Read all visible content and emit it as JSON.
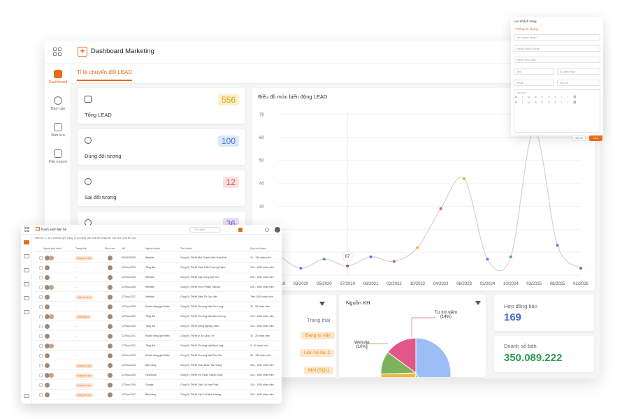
{
  "app": {
    "title": "Dashboard Marketing",
    "active_tab": "Tỉ lệ chuyển đổi LEAD"
  },
  "sidebar": [
    {
      "label": "Dashboard",
      "active": true
    },
    {
      "label": "Báo cáo",
      "active": false
    },
    {
      "label": "Bản lưu",
      "active": false
    },
    {
      "label": "File export",
      "active": false
    }
  ],
  "stats": [
    {
      "label": "Tổng LEAD",
      "value": "556",
      "bg": "#fdf0c8",
      "fg": "#d9a21e"
    },
    {
      "label": "Đúng đối tượng",
      "value": "100",
      "bg": "#dde9fb",
      "fg": "#3f74c8"
    },
    {
      "label": "Sai đối tượng",
      "value": "12",
      "bg": "#fbe0e0",
      "fg": "#d9534f"
    },
    {
      "label": "",
      "value": "36",
      "bg": "#e9e2fa",
      "fg": "#7a5ac8"
    }
  ],
  "chart_data": {
    "type": "line",
    "title": "Biểu đồ mức biến động LEAD",
    "categories": [
      "12/2019",
      "03/2020",
      "05/2020",
      "07/2020",
      "08/2021",
      "02/2022",
      "10/2022",
      "04/2023",
      "08/2023",
      "03/2024",
      "10/2024",
      "03/2025",
      "08/2025",
      "02/2026"
    ],
    "values": [
      9,
      3,
      7,
      4,
      8,
      6,
      12,
      29,
      42,
      7,
      8,
      63,
      13,
      3
    ],
    "point_colors": [
      "#e0e0e0",
      "#5b7fd8",
      "#4caf50",
      "#b05a2a",
      "#5b7fd8",
      "#d94a8c",
      "#f2b01e",
      "#e2574c",
      "#f2b01e",
      "#5b7fd8",
      "#4caf50",
      "#bbbbbb",
      "#5b7fd8",
      "#8a5ac8"
    ],
    "yticks": [
      0,
      10,
      20,
      30,
      40,
      50,
      60,
      70
    ],
    "ylim": [
      0,
      70
    ],
    "tooltip_label": "07",
    "tooltip_index": 3
  },
  "status_card": {
    "header": "Trạng thái",
    "pills": [
      "Đang tư vấn",
      "Liên hệ lần 2",
      "Mới (SQL)"
    ]
  },
  "source_card": {
    "title": "Nguồn KH",
    "labels": [
      {
        "text": "Tự tìm kiếm",
        "pct": "(14%)"
      },
      {
        "text": "Website",
        "pct": "(10%)"
      }
    ],
    "slices": [
      {
        "value": 40,
        "color": "#9dbdf7"
      },
      {
        "value": 8,
        "color": "#4fb8b0"
      },
      {
        "value": 22,
        "color": "#f2b63a"
      },
      {
        "value": 10,
        "color": "#7cb35a"
      },
      {
        "value": 14,
        "color": "#e2578a"
      }
    ]
  },
  "contracts": {
    "label": "Hợp đồng bán",
    "value": "169",
    "color": "#3f6fb8"
  },
  "revenue": {
    "label": "Doanh số bán",
    "value": "350.089.222",
    "color": "#2e9a55"
  },
  "form": {
    "header": "Lọc Khách hàng",
    "section": "• Thông tin chung",
    "fields": [
      "Tên khách hàng *",
      "Nguồn khách hàng *",
      "Người phụ trách",
      "Tỉnh",
      "Số điện thoại",
      "Email",
      "Địa chỉ",
      "Ghi chú"
    ],
    "toolbar": "B I U S ≡ ≡ ≡ ⁝ ⁝ ⛓",
    "cancel": "Hủy bỏ",
    "save": "Lưu"
  },
  "list": {
    "title": "Danh sách liên hệ",
    "search_placeholder": "Tìm kiếm",
    "toolbar": "Hiển thị 1 - 15 / 128 bản ghi     Trang 1     Lọc nâng cao     Xuất file     Nhập file     Tạo mới     Chia sẻ     Xóa",
    "columns": [
      "Người phụ trách",
      "Trạng thái",
      "Phụ trách",
      "Mã",
      "Nguồn khách",
      "Tên khách",
      "Quy mô khách"
    ],
    "rows": [
      {
        "status": "Đang tư vấn",
        "code": "KH20231001",
        "source": "Website",
        "name": "Công Ty TNHH Một Thành Viên Hoà Bình",
        "scale": "10 - 100 nhân viên"
      },
      {
        "status": "",
        "code": "12Thuc1234",
        "source": "Tổng đài",
        "name": "Công Ty TNHH Phát Triển Trường Thịnh",
        "scale": "100 - 1000 nhân viên"
      },
      {
        "status": "",
        "code": "12Thuc1235",
        "source": "Website",
        "name": "Công Ty TNHH Xây Dựng Đại Việt",
        "scale": "200 - 1000 nhân viên"
      },
      {
        "status": "",
        "code": "12Thuc1236",
        "source": "Website",
        "name": "Công Ty TNHH Thực Phẩm Tâm An",
        "scale": "200 - 1000 nhân viên"
      },
      {
        "status": "Liên hệ lần 2",
        "code": "12Thuc1237",
        "source": "Website",
        "name": "Công Ty TNHH Điện Tử Sao Việt",
        "scale": "Trên 1000 nhân viên"
      },
      {
        "status": "",
        "code": "12Thuc1238",
        "source": "Khách hàng giới thiệu",
        "name": "Công Ty TNHH Thương Mại Kim Long",
        "scale": "10 - 50 nhân viên"
      },
      {
        "status": "Mới (SQL)",
        "code": "12Thuc1239",
        "source": "Tổng đài",
        "name": "Công Ty TNHH Thương Mại Ánh Dương",
        "scale": "100 - 1000 nhân viên"
      },
      {
        "status": "",
        "code": "12Thuc1240",
        "source": "Tổng đài",
        "name": "Công Ty TNHH Nông Nghiệp Xanh",
        "scale": "100 - 1000 nhân viên"
      },
      {
        "status": "",
        "code": "12Thuc1241",
        "source": "Khách hàng giới thiệu",
        "name": "Công Ty TNHH In Ấn Quốc Tế",
        "scale": "10 - 20 nhân viên"
      },
      {
        "status": "",
        "code": "12Thuc1242",
        "source": "Tổng đài",
        "name": "Công Ty TNHH Thương Mại Bảo Long",
        "scale": "5 - 20 nhân viên"
      },
      {
        "status": "",
        "code": "12Thuc1243",
        "source": "Khách hàng giới thiệu",
        "name": "Công Ty TNHH Thương Mại Phú Gia",
        "scale": "50 - 100 nhân viên"
      },
      {
        "status": "Đang tư vấn",
        "code": "12Thuc1244",
        "source": "Bán hàng",
        "name": "Công Ty TNHH Giao Nhận Tân Cảng",
        "scale": "100 - 1000 nhân viên"
      },
      {
        "status": "Đang tư vấn",
        "code": "12Thuc1245",
        "source": "Facebook",
        "name": "Công Ty TNHH Kỹ Thuật Thành Công",
        "scale": "100 - 1000 nhân viên"
      },
      {
        "status": "Đang tư vấn",
        "code": "12Thuc1246",
        "source": "Google",
        "name": "Công Ty TNHH Dịch Vụ Hoà Phát",
        "scale": "100 - 1000 nhân viên"
      },
      {
        "status": "Đang tư vấn",
        "code": "12Thuc1247",
        "source": "Bán hàng",
        "name": "Công Ty TNHH Vận Tải Minh Khang",
        "scale": "100 - 1000 nhân viên"
      }
    ]
  }
}
